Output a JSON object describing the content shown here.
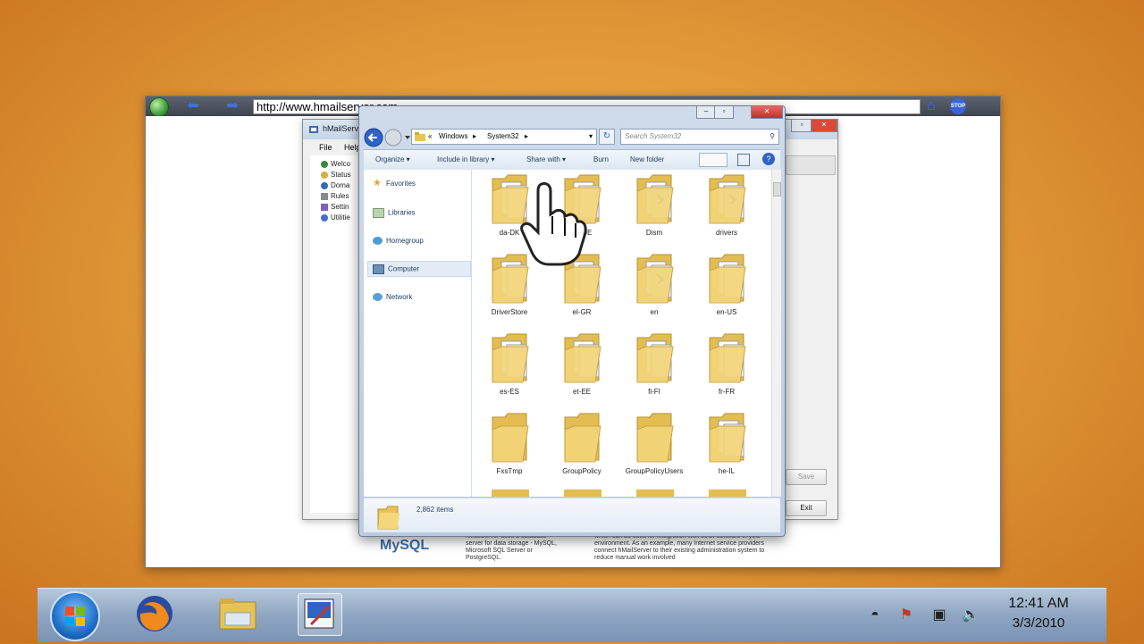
{
  "browser": {
    "url": "http://www.hmailserver.com",
    "stop_label": "STOP"
  },
  "hmail": {
    "title": "hMailServ",
    "menu": [
      "File",
      "Help"
    ],
    "tree": [
      "Welco",
      "Status",
      "Doma",
      "Rules",
      "Settin",
      "Utilitie"
    ],
    "save_label": "Save",
    "exit_label": "Exit"
  },
  "web": {
    "col1": "hMailServer uses a database server for data storage - MySQL, Microsoft SQL Server or PostgreSQL.",
    "col2": "which can be used for integration with other software in your environment. As an example, many Internet service providers connect hMailServer to their existing administration system to reduce manual work involved",
    "logo": "MySQL"
  },
  "explorer": {
    "breadcrumb": [
      "«",
      "Windows",
      "System32"
    ],
    "search_placeholder": "Search System32",
    "commands": [
      "Organize ▾",
      "Include in library ▾",
      "Share with ▾",
      "Burn",
      "New folder"
    ],
    "nav": [
      "Favorites",
      "Libraries",
      "Homegroup",
      "Computer",
      "Network"
    ],
    "folders": [
      {
        "name": "da-DK",
        "kind": "docs"
      },
      {
        "name": "de-DE",
        "kind": "docs"
      },
      {
        "name": "Dism",
        "kind": "dism"
      },
      {
        "name": "drivers",
        "kind": "dism"
      },
      {
        "name": "DriverStore",
        "kind": "docs"
      },
      {
        "name": "el-GR",
        "kind": "docs"
      },
      {
        "name": "en",
        "kind": "dism"
      },
      {
        "name": "en-US",
        "kind": "docs"
      },
      {
        "name": "es-ES",
        "kind": "docs"
      },
      {
        "name": "et-EE",
        "kind": "docs"
      },
      {
        "name": "fi-FI",
        "kind": "docs"
      },
      {
        "name": "fr-FR",
        "kind": "docs"
      },
      {
        "name": "FxsTmp",
        "kind": "empty"
      },
      {
        "name": "GroupPolicy",
        "kind": "empty"
      },
      {
        "name": "GroupPolicyUsers",
        "kind": "empty"
      },
      {
        "name": "he-IL",
        "kind": "docs"
      }
    ],
    "item_count": "2,862 items"
  },
  "taskbar": {
    "time": "12:41 AM",
    "date": "3/3/2010"
  }
}
